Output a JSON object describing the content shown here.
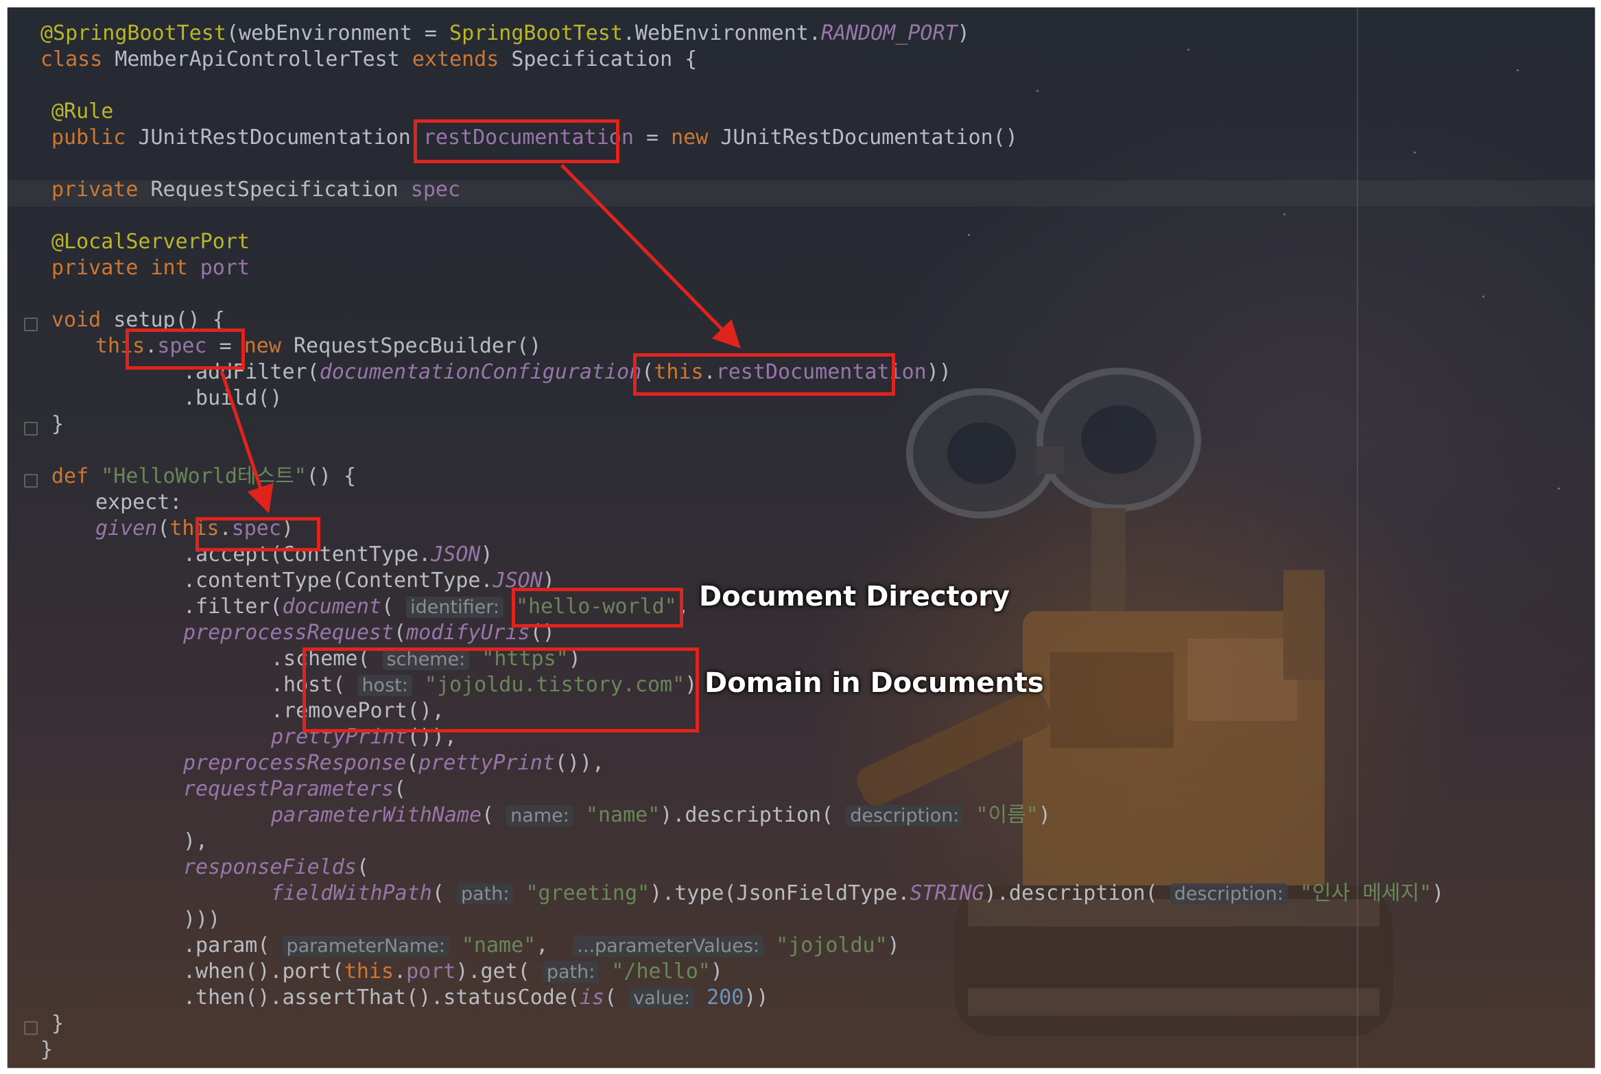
{
  "lines": [
    {
      "ind": "ind0",
      "parts": [
        {
          "c": "ann",
          "t": "@SpringBootTest"
        },
        {
          "t": "(webEnvironment = "
        },
        {
          "c": "ann",
          "t": "SpringBootTest"
        },
        {
          "t": ".WebEnvironment."
        },
        {
          "c": "it",
          "t": "RANDOM_PORT"
        },
        {
          "t": ")"
        }
      ]
    },
    {
      "ind": "ind0",
      "parts": [
        {
          "c": "kw",
          "t": "class "
        },
        {
          "t": "MemberApiControllerTest "
        },
        {
          "c": "kw",
          "t": "extends "
        },
        {
          "t": "Specification {"
        }
      ]
    },
    {
      "ind": "ind0",
      "parts": []
    },
    {
      "ind": "ind1",
      "parts": [
        {
          "c": "ann",
          "t": "@Rule"
        }
      ]
    },
    {
      "ind": "ind1",
      "parts": [
        {
          "c": "kw",
          "t": "public "
        },
        {
          "t": "JUnitRestDocumentation "
        },
        {
          "c": "fld",
          "t": "restDocumentation"
        },
        {
          "t": " = "
        },
        {
          "c": "kw",
          "t": "new "
        },
        {
          "t": "JUnitRestDocumentation()"
        }
      ]
    },
    {
      "ind": "ind0",
      "parts": []
    },
    {
      "ind": "ind1",
      "parts": [
        {
          "c": "kw",
          "t": "private "
        },
        {
          "t": "RequestSpecification "
        },
        {
          "c": "fld",
          "t": "spec"
        }
      ]
    },
    {
      "ind": "ind0",
      "parts": []
    },
    {
      "ind": "ind1",
      "parts": [
        {
          "c": "ann",
          "t": "@LocalServerPort"
        }
      ]
    },
    {
      "ind": "ind1",
      "parts": [
        {
          "c": "kw",
          "t": "private int "
        },
        {
          "c": "fld",
          "t": "port"
        }
      ]
    },
    {
      "ind": "ind0",
      "parts": []
    },
    {
      "ind": "ind1",
      "parts": [
        {
          "c": "kw",
          "t": "void "
        },
        {
          "t": "setup() {"
        }
      ]
    },
    {
      "ind": "ind2",
      "parts": [
        {
          "c": "kw",
          "t": "this"
        },
        {
          "t": "."
        },
        {
          "c": "fld",
          "t": "spec"
        },
        {
          "t": " = "
        },
        {
          "c": "kw",
          "t": "new "
        },
        {
          "t": "RequestSpecBuilder()"
        }
      ]
    },
    {
      "ind": "ind3",
      "parts": [
        {
          "t": ".addFilter("
        },
        {
          "c": "it",
          "t": "documentationConfiguration"
        },
        {
          "t": "("
        },
        {
          "c": "kw",
          "t": "this"
        },
        {
          "t": "."
        },
        {
          "c": "fld",
          "t": "restDocumentation"
        },
        {
          "t": "))"
        }
      ]
    },
    {
      "ind": "ind3",
      "parts": [
        {
          "t": ".build()"
        }
      ]
    },
    {
      "ind": "ind1",
      "parts": [
        {
          "t": "}"
        }
      ]
    },
    {
      "ind": "ind0",
      "parts": []
    },
    {
      "ind": "ind1",
      "parts": [
        {
          "c": "kw",
          "t": "def "
        },
        {
          "c": "str",
          "t": "\"HelloWorld테스트\""
        },
        {
          "t": "() {"
        }
      ]
    },
    {
      "ind": "ind2",
      "parts": [
        {
          "t": "expect:"
        }
      ]
    },
    {
      "ind": "ind2",
      "parts": [
        {
          "c": "it",
          "t": "given"
        },
        {
          "t": "("
        },
        {
          "c": "kw",
          "t": "this"
        },
        {
          "t": "."
        },
        {
          "c": "fld",
          "t": "spec"
        },
        {
          "t": ")"
        }
      ]
    },
    {
      "ind": "ind3",
      "parts": [
        {
          "t": ".accept(ContentType."
        },
        {
          "c": "it",
          "t": "JSON"
        },
        {
          "t": ")"
        }
      ]
    },
    {
      "ind": "ind3",
      "parts": [
        {
          "t": ".contentType(ContentType."
        },
        {
          "c": "it",
          "t": "JSON"
        },
        {
          "t": ")"
        }
      ]
    },
    {
      "ind": "ind3",
      "parts": [
        {
          "t": ".filter("
        },
        {
          "c": "it",
          "t": "document"
        },
        {
          "t": "( "
        },
        {
          "c": "hint",
          "t": "identifier:"
        },
        {
          "t": " "
        },
        {
          "c": "str",
          "t": "\"hello-world\""
        },
        {
          "t": ","
        }
      ]
    },
    {
      "ind": "ind3",
      "parts": [
        {
          "c": "it",
          "t": "preprocessRequest"
        },
        {
          "t": "("
        },
        {
          "c": "it",
          "t": "modifyUris"
        },
        {
          "t": "()"
        }
      ]
    },
    {
      "ind": "ind4",
      "parts": [
        {
          "t": ".scheme( "
        },
        {
          "c": "hint",
          "t": "scheme:"
        },
        {
          "t": " "
        },
        {
          "c": "str",
          "t": "\"https\""
        },
        {
          "t": ")"
        }
      ]
    },
    {
      "ind": "ind4",
      "parts": [
        {
          "t": ".host( "
        },
        {
          "c": "hint",
          "t": "host:"
        },
        {
          "t": " "
        },
        {
          "c": "str",
          "t": "\"jojoldu.tistory.com\""
        },
        {
          "t": ")"
        }
      ]
    },
    {
      "ind": "ind4",
      "parts": [
        {
          "t": ".removePort(),"
        }
      ]
    },
    {
      "ind": "ind4",
      "parts": [
        {
          "c": "it",
          "t": "prettyPrint"
        },
        {
          "t": "()),"
        }
      ]
    },
    {
      "ind": "ind3",
      "parts": [
        {
          "c": "it",
          "t": "preprocessResponse"
        },
        {
          "t": "("
        },
        {
          "c": "it",
          "t": "prettyPrint"
        },
        {
          "t": "()),"
        }
      ]
    },
    {
      "ind": "ind3",
      "parts": [
        {
          "c": "it",
          "t": "requestParameters"
        },
        {
          "t": "("
        }
      ]
    },
    {
      "ind": "ind4",
      "parts": [
        {
          "c": "it",
          "t": "parameterWithName"
        },
        {
          "t": "( "
        },
        {
          "c": "hint",
          "t": "name:"
        },
        {
          "t": " "
        },
        {
          "c": "str",
          "t": "\"name\""
        },
        {
          "t": ").description( "
        },
        {
          "c": "hint",
          "t": "description:"
        },
        {
          "t": " "
        },
        {
          "c": "str",
          "t": "\"이름\""
        },
        {
          "t": ")"
        }
      ]
    },
    {
      "ind": "ind3",
      "parts": [
        {
          "t": "),"
        }
      ]
    },
    {
      "ind": "ind3",
      "parts": [
        {
          "c": "it",
          "t": "responseFields"
        },
        {
          "t": "("
        }
      ]
    },
    {
      "ind": "ind4",
      "parts": [
        {
          "c": "it",
          "t": "fieldWithPath"
        },
        {
          "t": "( "
        },
        {
          "c": "hint",
          "t": "path:"
        },
        {
          "t": " "
        },
        {
          "c": "str",
          "t": "\"greeting\""
        },
        {
          "t": ").type(JsonFieldType."
        },
        {
          "c": "it",
          "t": "STRING"
        },
        {
          "t": ").description( "
        },
        {
          "c": "hint",
          "t": "description:"
        },
        {
          "t": " "
        },
        {
          "c": "str",
          "t": "\"인사 메세지\""
        },
        {
          "t": ")"
        }
      ]
    },
    {
      "ind": "ind3",
      "parts": [
        {
          "t": ")))"
        }
      ]
    },
    {
      "ind": "ind3",
      "parts": [
        {
          "t": ".param( "
        },
        {
          "c": "hint",
          "t": "parameterName:"
        },
        {
          "t": " "
        },
        {
          "c": "str",
          "t": "\"name\""
        },
        {
          "t": ",  "
        },
        {
          "c": "hint",
          "t": "...parameterValues:"
        },
        {
          "t": " "
        },
        {
          "c": "str",
          "t": "\"jojoldu\""
        },
        {
          "t": ")"
        }
      ]
    },
    {
      "ind": "ind3",
      "parts": [
        {
          "t": ".when().port("
        },
        {
          "c": "kw",
          "t": "this"
        },
        {
          "t": "."
        },
        {
          "c": "fld",
          "t": "port"
        },
        {
          "t": ").get( "
        },
        {
          "c": "hint",
          "t": "path:"
        },
        {
          "t": " "
        },
        {
          "c": "str",
          "t": "\"/hello\""
        },
        {
          "t": ")"
        }
      ]
    },
    {
      "ind": "ind3",
      "parts": [
        {
          "t": ".then().assertThat().statusCode("
        },
        {
          "c": "it",
          "t": "is"
        },
        {
          "t": "( "
        },
        {
          "c": "hint",
          "t": "value:"
        },
        {
          "t": " "
        },
        {
          "c": "num",
          "t": "200"
        },
        {
          "t": "))"
        }
      ]
    },
    {
      "ind": "ind1",
      "parts": [
        {
          "t": "}"
        }
      ]
    },
    {
      "ind": "ind0",
      "parts": [
        {
          "t": "}"
        }
      ]
    }
  ],
  "callouts": {
    "document_directory": "Document Directory",
    "domain_in_documents": "Domain in Documents"
  },
  "colors": {
    "highlight_box": "#e0241d",
    "keyword": "#cc7832",
    "annotation": "#bbb529",
    "field": "#9876aa",
    "string": "#6a8759"
  }
}
